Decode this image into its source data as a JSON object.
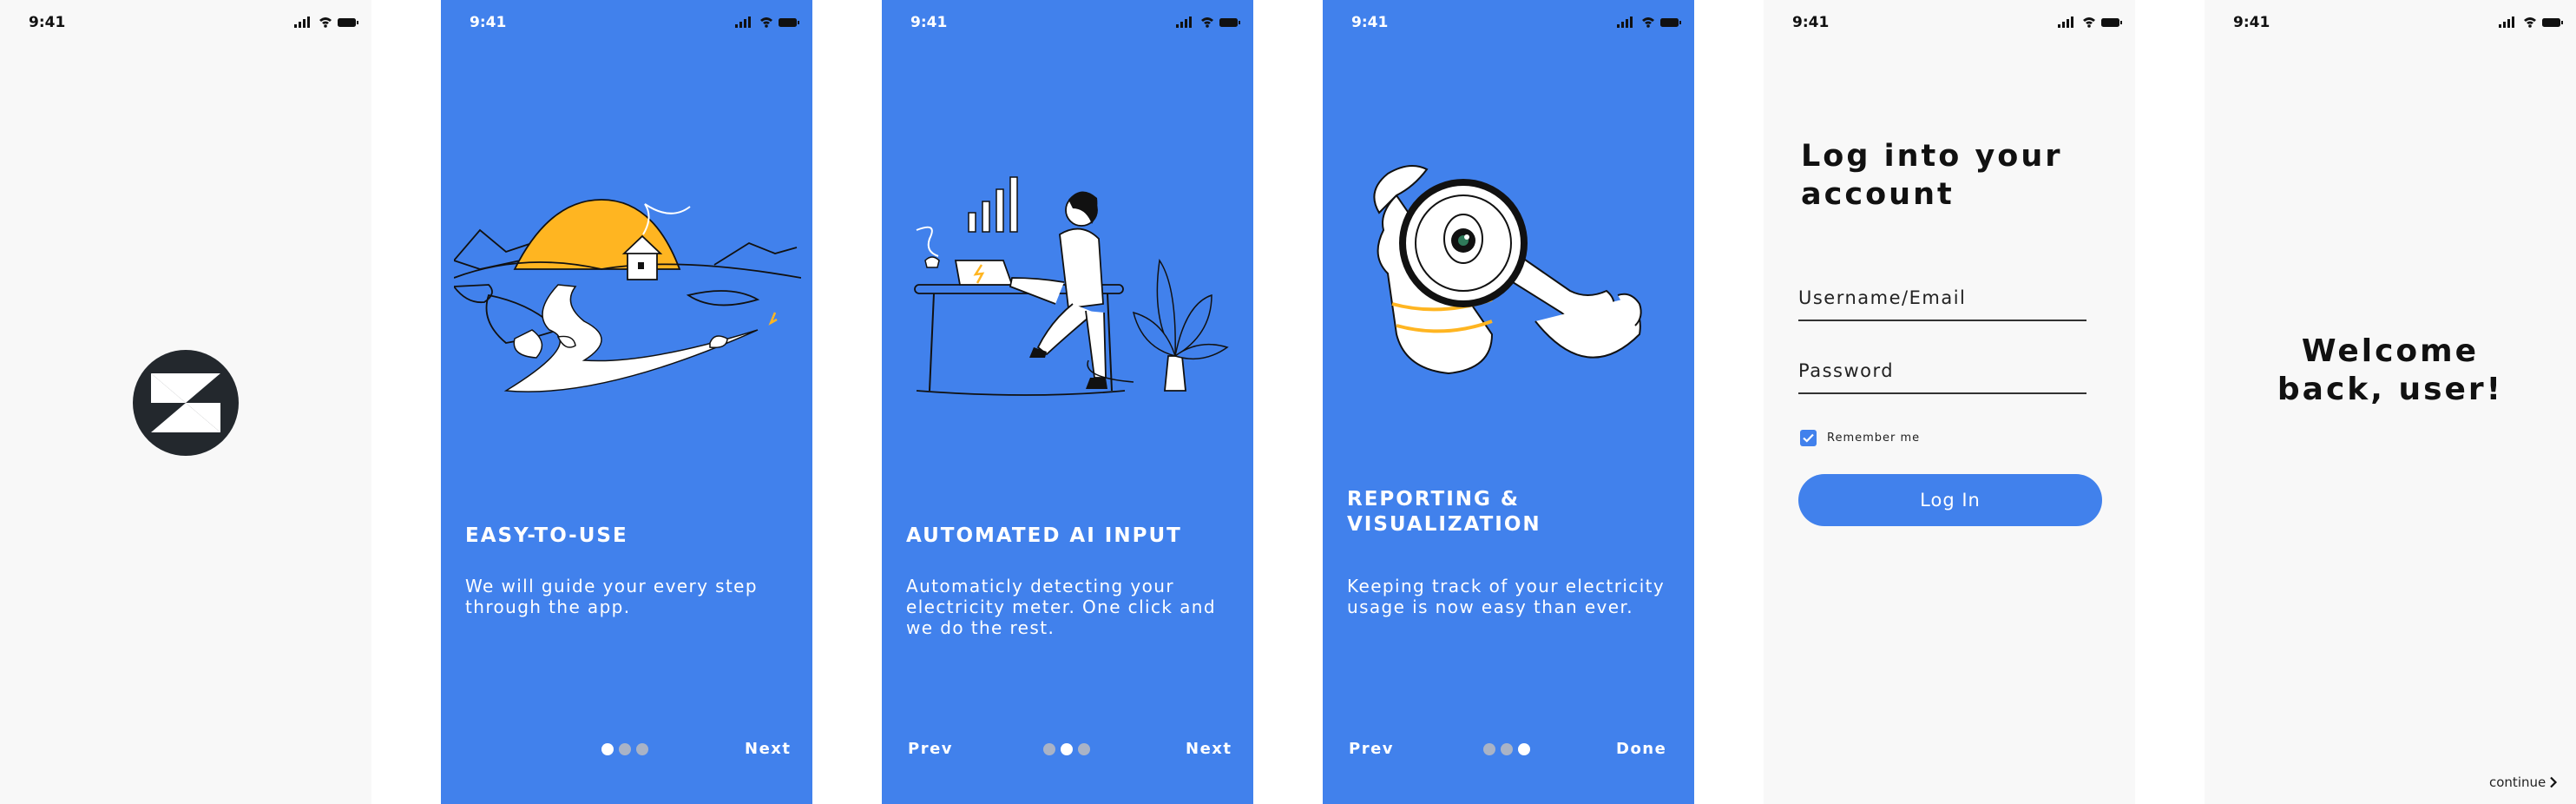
{
  "status_bar": {
    "time": "9:41"
  },
  "onboarding": [
    {
      "title": "EASY-TO-USE",
      "body": "We will guide your every step through the app.",
      "next": "Next",
      "active_dot": 1
    },
    {
      "title": "AUTOMATED AI INPUT",
      "body": "Automaticly detecting your electricity meter. One click and we do the rest.",
      "prev": "Prev",
      "next": "Next",
      "active_dot": 2
    },
    {
      "title": "REPORTING & VISUALIZATION",
      "body": "Keeping track of your electricity usage is now easy than ever.",
      "prev": "Prev",
      "done": "Done",
      "active_dot": 3
    }
  ],
  "login": {
    "title": "Log into your account",
    "username_placeholder": "Username/Email",
    "password_placeholder": "Password",
    "remember_label": "Remember me",
    "remember_checked": true,
    "button": "Log In"
  },
  "welcome": {
    "message": "Welcome back, user!",
    "continue": "continue"
  },
  "colors": {
    "primary_blue": "#4181ec",
    "accent_yellow": "#ffb521",
    "logo_dark": "#23282d",
    "light_bg": "#f8f8f8"
  }
}
